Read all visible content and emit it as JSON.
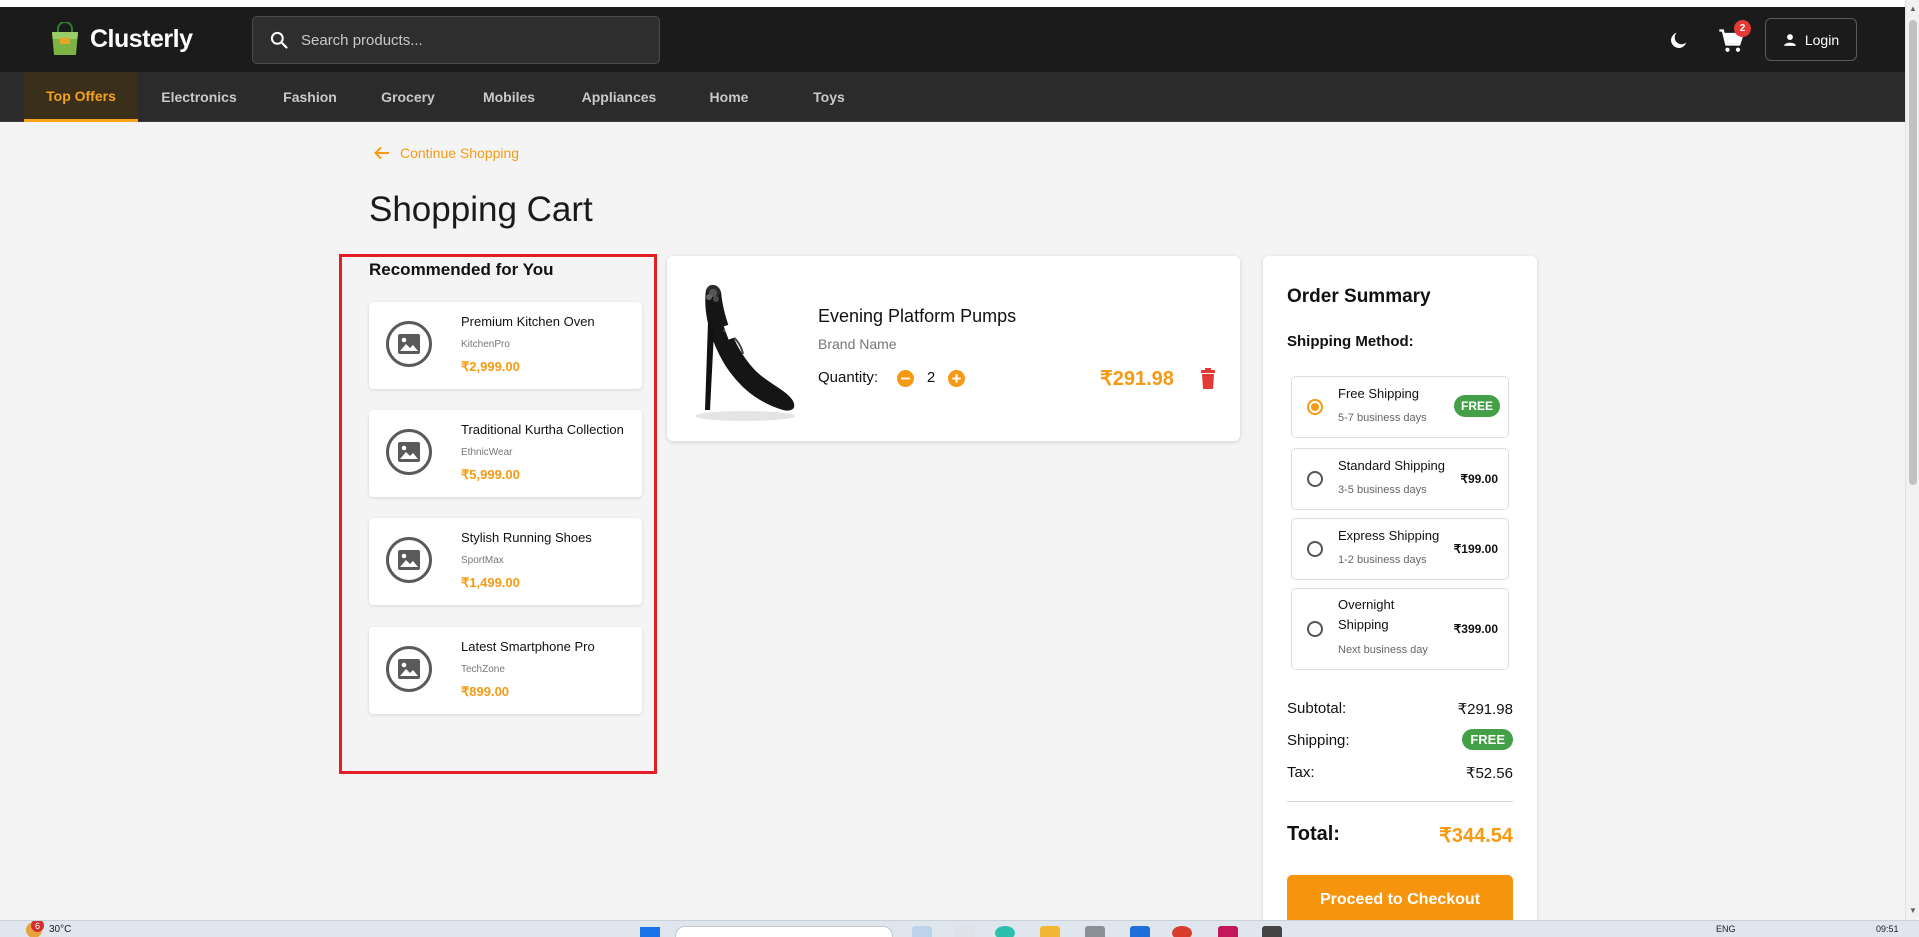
{
  "brand": {
    "name": "Clusterly"
  },
  "search": {
    "placeholder": "Search products..."
  },
  "header": {
    "cart_count": "2",
    "login_label": "Login"
  },
  "nav": {
    "items": [
      {
        "label": "Top Offers",
        "active": true
      },
      {
        "label": "Electronics"
      },
      {
        "label": "Fashion"
      },
      {
        "label": "Grocery"
      },
      {
        "label": "Mobiles"
      },
      {
        "label": "Appliances"
      },
      {
        "label": "Home"
      },
      {
        "label": "Toys"
      }
    ]
  },
  "page": {
    "continue_label": "Continue Shopping",
    "title": "Shopping Cart"
  },
  "recommended": {
    "title": "Recommended for You",
    "items": [
      {
        "name": "Premium Kitchen Oven",
        "brand": "KitchenPro",
        "price": "₹2,999.00"
      },
      {
        "name": "Traditional Kurtha Collection",
        "brand": "EthnicWear",
        "price": "₹5,999.00"
      },
      {
        "name": "Stylish Running Shoes",
        "brand": "SportMax",
        "price": "₹1,499.00"
      },
      {
        "name": "Latest Smartphone Pro",
        "brand": "TechZone",
        "price": "₹899.00"
      }
    ]
  },
  "cart_item": {
    "name": "Evening Platform Pumps",
    "brand": "Brand Name",
    "quantity_label": "Quantity:",
    "quantity": "2",
    "price": "₹291.98"
  },
  "summary": {
    "title": "Order Summary",
    "shipping_method_label": "Shipping Method:",
    "options": [
      {
        "name": "Free Shipping",
        "days": "5-7 business days",
        "price": "FREE",
        "selected": true
      },
      {
        "name": "Standard Shipping",
        "days": "3-5 business days",
        "price": "₹99.00"
      },
      {
        "name": "Express Shipping",
        "days": "1-2 business days",
        "price": "₹199.00"
      },
      {
        "name": "Overnight Shipping",
        "days": "Next business day",
        "price": "₹399.00"
      }
    ],
    "subtotal_label": "Subtotal:",
    "subtotal": "₹291.98",
    "shipping_label": "Shipping:",
    "shipping": "FREE",
    "tax_label": "Tax:",
    "tax": "₹52.56",
    "total_label": "Total:",
    "total": "₹344.54",
    "checkout_label": "Proceed to Checkout"
  },
  "taskbar": {
    "weather_badge": "6",
    "temperature": "30°C",
    "language": "ENG",
    "time": "09:51"
  },
  "colors": {
    "accent": "#f59a12",
    "header_bg": "#1b1b1b",
    "nav_bg": "#2b2b2b",
    "free_green": "#43a047",
    "highlight_red": "#e41d26"
  }
}
